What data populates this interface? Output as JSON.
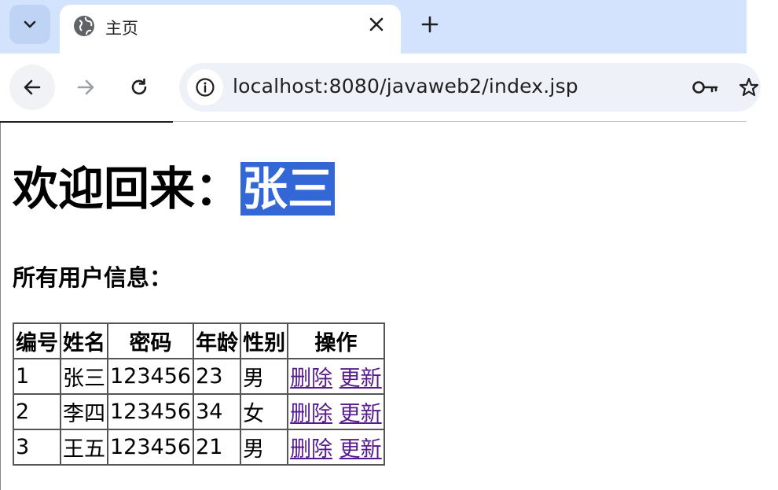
{
  "browser": {
    "tab_title": "主页",
    "url": "localhost:8080/javaweb2/index.jsp"
  },
  "page": {
    "welcome_prefix": "欢迎回来：",
    "welcome_name": "张三",
    "subtitle": "所有用户信息：",
    "table": {
      "headers": [
        "编号",
        "姓名",
        "密码",
        "年龄",
        "性别",
        "操作"
      ],
      "rows": [
        {
          "id": "1",
          "name": "张三",
          "password": "123456",
          "age": "23",
          "gender": "男"
        },
        {
          "id": "2",
          "name": "李四",
          "password": "123456",
          "age": "34",
          "gender": "女"
        },
        {
          "id": "3",
          "name": "王五",
          "password": "123456",
          "age": "21",
          "gender": "男"
        }
      ],
      "delete_label": "删除",
      "update_label": "更新"
    }
  }
}
